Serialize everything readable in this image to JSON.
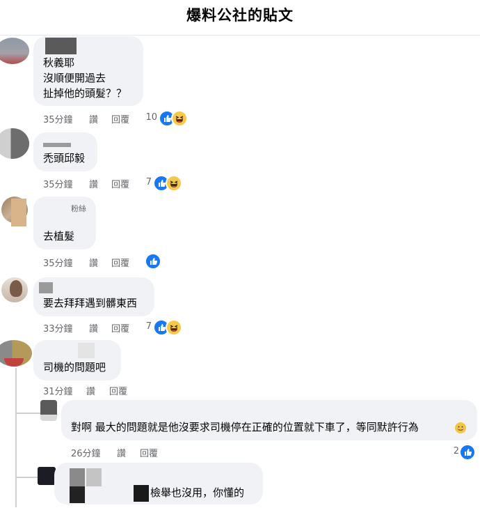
{
  "header": {
    "title": "爆料公社的貼文"
  },
  "actions": {
    "like": "讚",
    "reply": "回覆"
  },
  "comments": [
    {
      "lines": [
        "秋義耶",
        "沒順便開過去",
        "扯掉他的頭髮？？"
      ],
      "time": "35分鐘",
      "reactions": "10"
    },
    {
      "lines": [
        "禿頭邱毅"
      ],
      "time": "35分鐘",
      "reactions": "7"
    },
    {
      "badge": "粉絲",
      "lines": [
        "去植髮"
      ],
      "time": "35分鐘",
      "reactions": ""
    },
    {
      "lines": [
        "要去拜拜遇到髒東西"
      ],
      "time": "33分鐘",
      "reactions": "7"
    },
    {
      "lines": [
        "司機的問題吧"
      ],
      "time": "31分鐘",
      "reactions": ""
    }
  ],
  "replies": [
    {
      "text": "對啊 最大的問題就是他沒要求司機停在正確的位置就下車了，等同默許行為",
      "time": "26分鐘",
      "reactions": "2"
    },
    {
      "text": "檢舉也沒用，你懂的"
    }
  ],
  "colors": {
    "like_blue": "#1877f2",
    "haha_yellow": "#f7c94b",
    "bubble_gray": "#f0f2f5",
    "meta_gray": "#65676b"
  }
}
